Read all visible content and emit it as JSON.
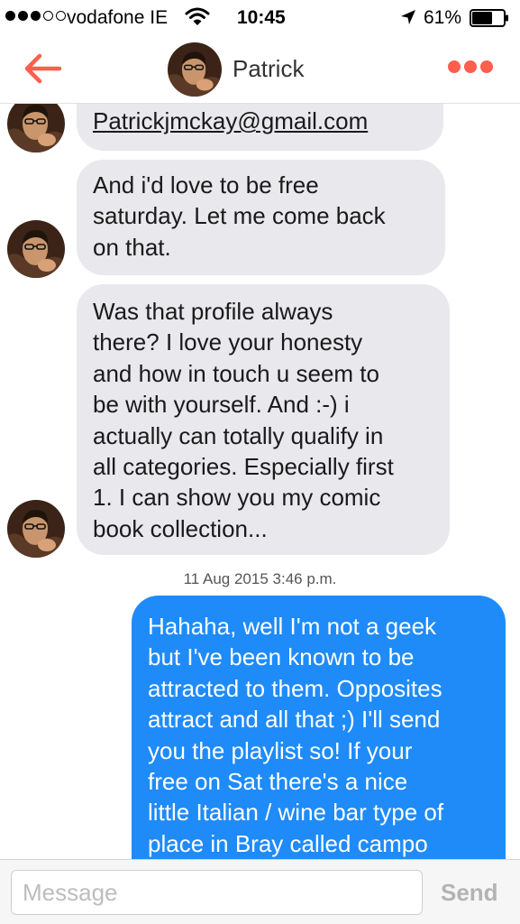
{
  "status_bar": {
    "carrier": "vodafone IE",
    "time": "10:45",
    "battery": "61%",
    "signal_bars_filled": 3,
    "signal_bars_total": 5
  },
  "header": {
    "contact_name": "Patrick",
    "back_icon": "back-arrow-icon",
    "more_icon": "more-dots-icon"
  },
  "messages": [
    {
      "direction": "incoming",
      "text": "Patrickjmckay@gmail.com"
    },
    {
      "direction": "incoming",
      "lines": [
        "And i'd love to be free",
        "saturday. Let me come back",
        "on that."
      ]
    },
    {
      "direction": "incoming",
      "lines": [
        "Was that profile always",
        "there? I love your honesty",
        "and how in touch u seem to",
        "be with yourself. And :-) i",
        "actually can totally qualify in",
        "all categories. Especially first",
        "1. I can show you my comic",
        "book collection..."
      ]
    },
    {
      "direction": "outgoing",
      "lines": [
        "Hahaha, well I'm not a geek",
        "but I've been known to be",
        "attracted to them. Opposites",
        "attract and all that ;) I'll send",
        "you the playlist so! If your",
        "free on Sat there's a nice",
        "little Italian / wine bar type of",
        "place in Bray called campo"
      ]
    }
  ],
  "timestamp": "11 Aug 2015 3:46 p.m.",
  "composer": {
    "placeholder": "Message",
    "value": "",
    "send_label": "Send"
  },
  "colors": {
    "accent": "#fd5e4e",
    "outgoing_bubble": "#1e8bf9",
    "incoming_bubble": "#e8e8ed"
  }
}
